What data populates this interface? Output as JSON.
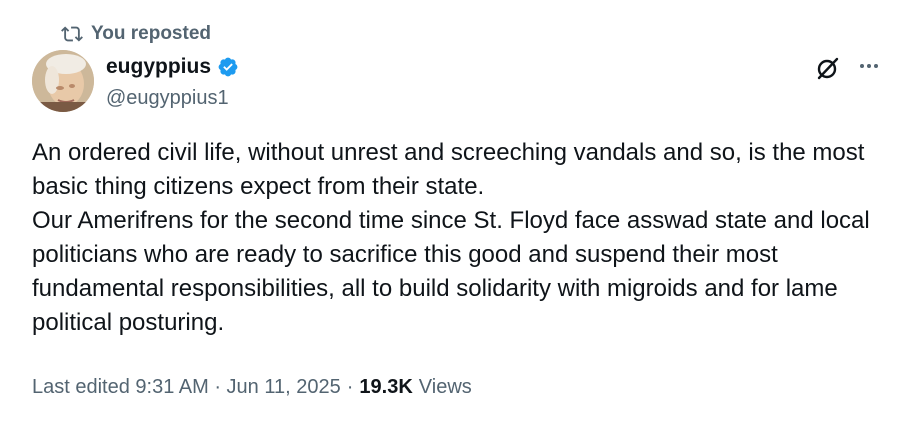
{
  "repost": {
    "label": "You reposted",
    "icon": "repost-icon"
  },
  "author": {
    "name": "eugyppius",
    "handle": "@eugyppius1",
    "verified_color": "#1d9bf0"
  },
  "tweet": {
    "lines": [
      "An ordered civil life, without unrest and screeching vandals and so, is the most basic thing citizens expect from their state.",
      "Our Amerifrens for the second time since St. Floyd face asswad state and local politicians who are ready to sacrifice this good and suspend their most fundamental responsibilities, all to build solidarity with migroids and for lame political posturing."
    ]
  },
  "meta": {
    "edited": "Last edited 9:31 AM · Jun 11, 2025",
    "sep": "·",
    "views_count": "19.3K",
    "views_label": "Views"
  },
  "icons": [
    "repost-icon",
    "verified-badge-icon",
    "grok-icon",
    "more-icon"
  ]
}
